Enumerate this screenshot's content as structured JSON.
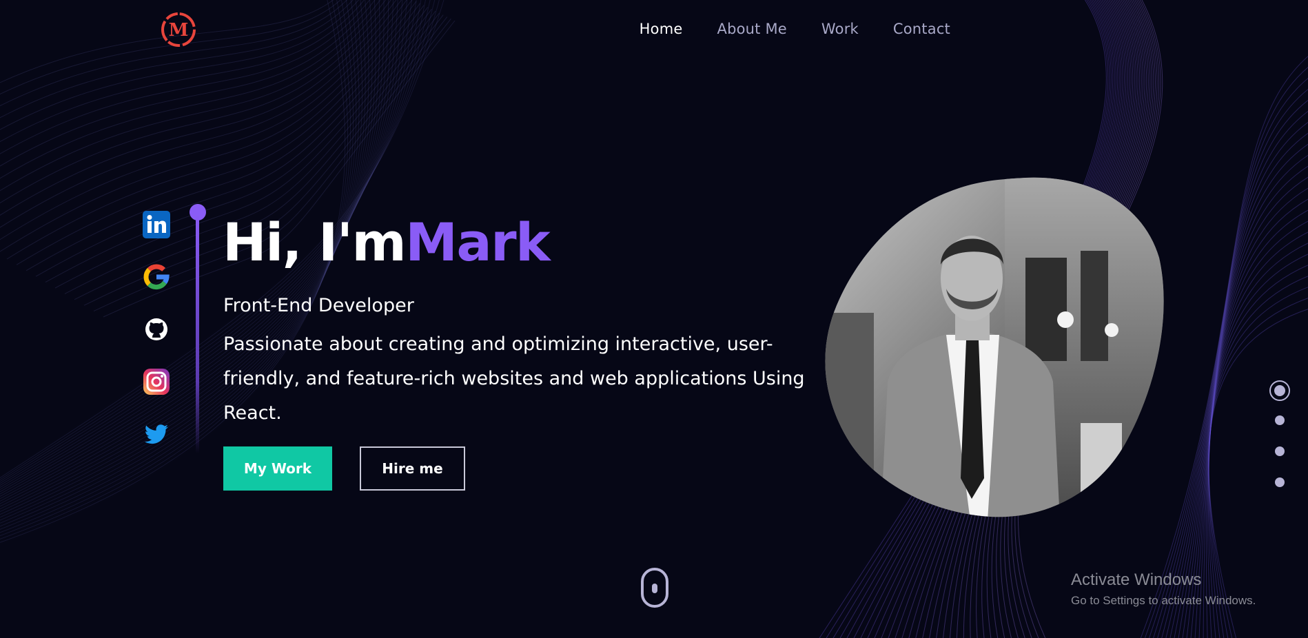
{
  "logo": {
    "letter": "M",
    "color": "#e8453c"
  },
  "nav": {
    "items": [
      {
        "label": "Home",
        "active": true
      },
      {
        "label": "About Me",
        "active": false
      },
      {
        "label": "Work",
        "active": false
      },
      {
        "label": "Contact",
        "active": false
      }
    ]
  },
  "socials": [
    {
      "icon": "linkedin-icon"
    },
    {
      "icon": "google-icon"
    },
    {
      "icon": "github-icon"
    },
    {
      "icon": "instagram-icon"
    },
    {
      "icon": "twitter-icon"
    }
  ],
  "hero": {
    "greeting": "Hi, I'm",
    "name": "Mark",
    "role": "Front-End Developer",
    "description": "Passionate about creating and optimizing interactive, user-friendly, and feature-rich websites and web applications Using React."
  },
  "buttons": {
    "primary": "My Work",
    "secondary": "Hire me"
  },
  "pagination": {
    "count": 4,
    "active_index": 0
  },
  "colors": {
    "accent": "#8a5cf6",
    "primary_button": "#10c8a4",
    "background": "#060716"
  },
  "watermark": {
    "title": "Activate Windows",
    "subtitle": "Go to Settings to activate Windows."
  }
}
